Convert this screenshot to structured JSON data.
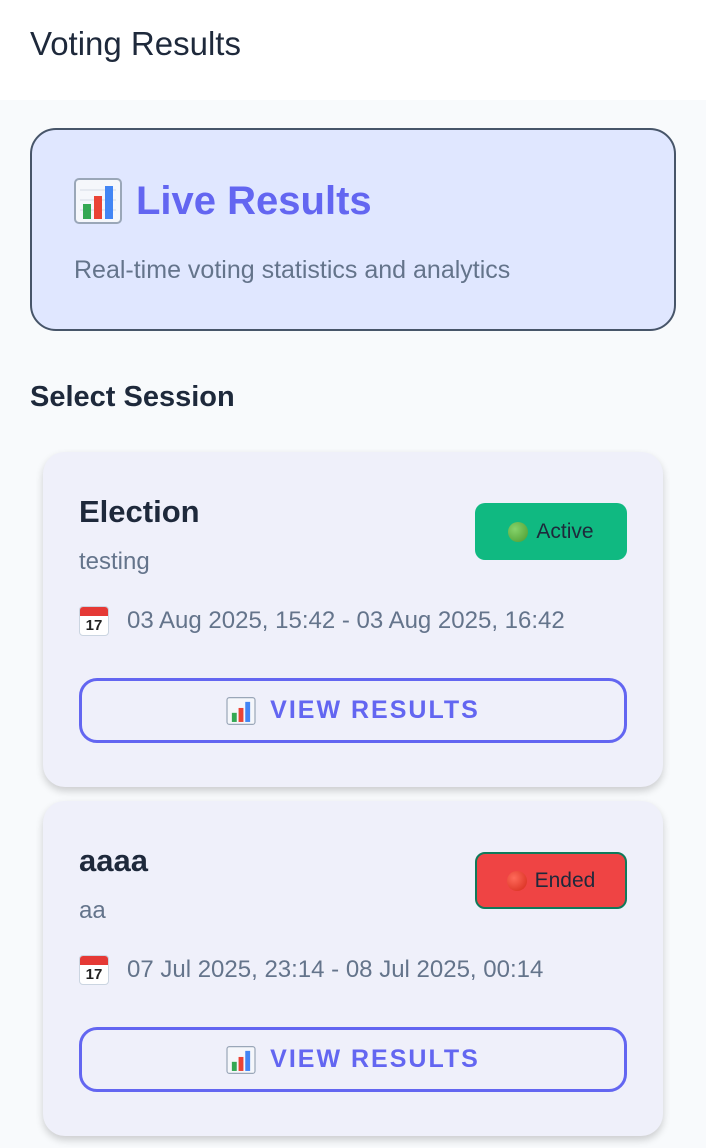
{
  "appbar": {
    "title": "Voting Results"
  },
  "hero": {
    "icon": "bar-chart-icon",
    "title": "Live Results",
    "subtitle": "Real-time voting statistics and analytics"
  },
  "section": {
    "title": "Select Session"
  },
  "sessions": [
    {
      "name": "Election",
      "description": "testing",
      "status": "Active",
      "status_color": "#10b981",
      "dates": "03 Aug 2025, 15:42 - 03 Aug 2025, 16:42",
      "button_label": "VIEW RESULTS"
    },
    {
      "name": "aaaa",
      "description": "aa",
      "status": "Ended",
      "status_color": "#ef4444",
      "dates": "07 Jul 2025, 23:14 - 08 Jul 2025, 00:14",
      "button_label": "VIEW RESULTS"
    }
  ],
  "colors": {
    "accent": "#6366f1",
    "hero_bg": "#e0e7ff",
    "card_bg": "#eff0fa"
  }
}
